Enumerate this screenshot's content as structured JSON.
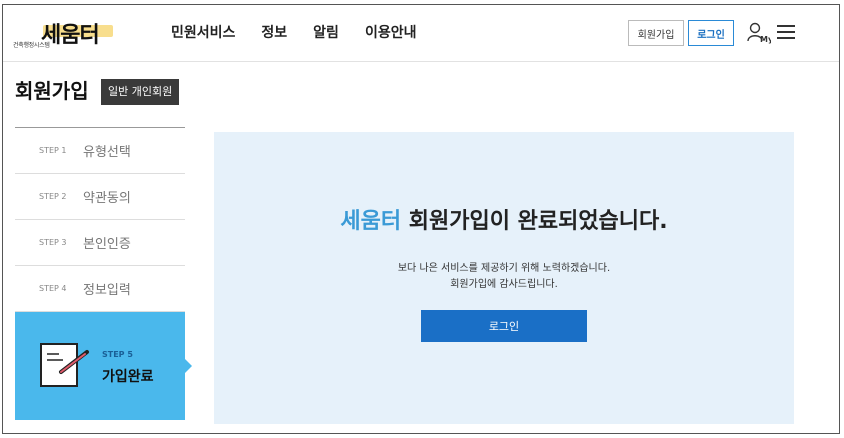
{
  "header": {
    "logo_main": "세움터",
    "logo_sub": "건축행정시스템",
    "nav": [
      "민원서비스",
      "정보",
      "알림",
      "이용안내"
    ],
    "join_label": "회원가입",
    "login_label": "로그인",
    "my_label": "My"
  },
  "page": {
    "title": "회원가입",
    "badge": "일반 개인회원"
  },
  "steps": [
    {
      "num": "STEP 1",
      "label": "유형선택"
    },
    {
      "num": "STEP 2",
      "label": "약관동의"
    },
    {
      "num": "STEP 3",
      "label": "본인인증"
    },
    {
      "num": "STEP 4",
      "label": "정보입력"
    }
  ],
  "active_step": {
    "num": "STEP 5",
    "label": "가입완료"
  },
  "panel": {
    "brand": "세움터",
    "title_rest": " 회원가입이 완료되었습니다.",
    "desc_line1": "보다 나은 서비스를 제공하기 위해 노력하겠습니다.",
    "desc_line2": "회원가입에 감사드립니다.",
    "button_label": "로그인"
  },
  "colors": {
    "accent": "#4ab8ec",
    "brand_text": "#3a9ad6",
    "primary_button": "#1a6fc6",
    "panel_bg": "#e6f1fa"
  }
}
